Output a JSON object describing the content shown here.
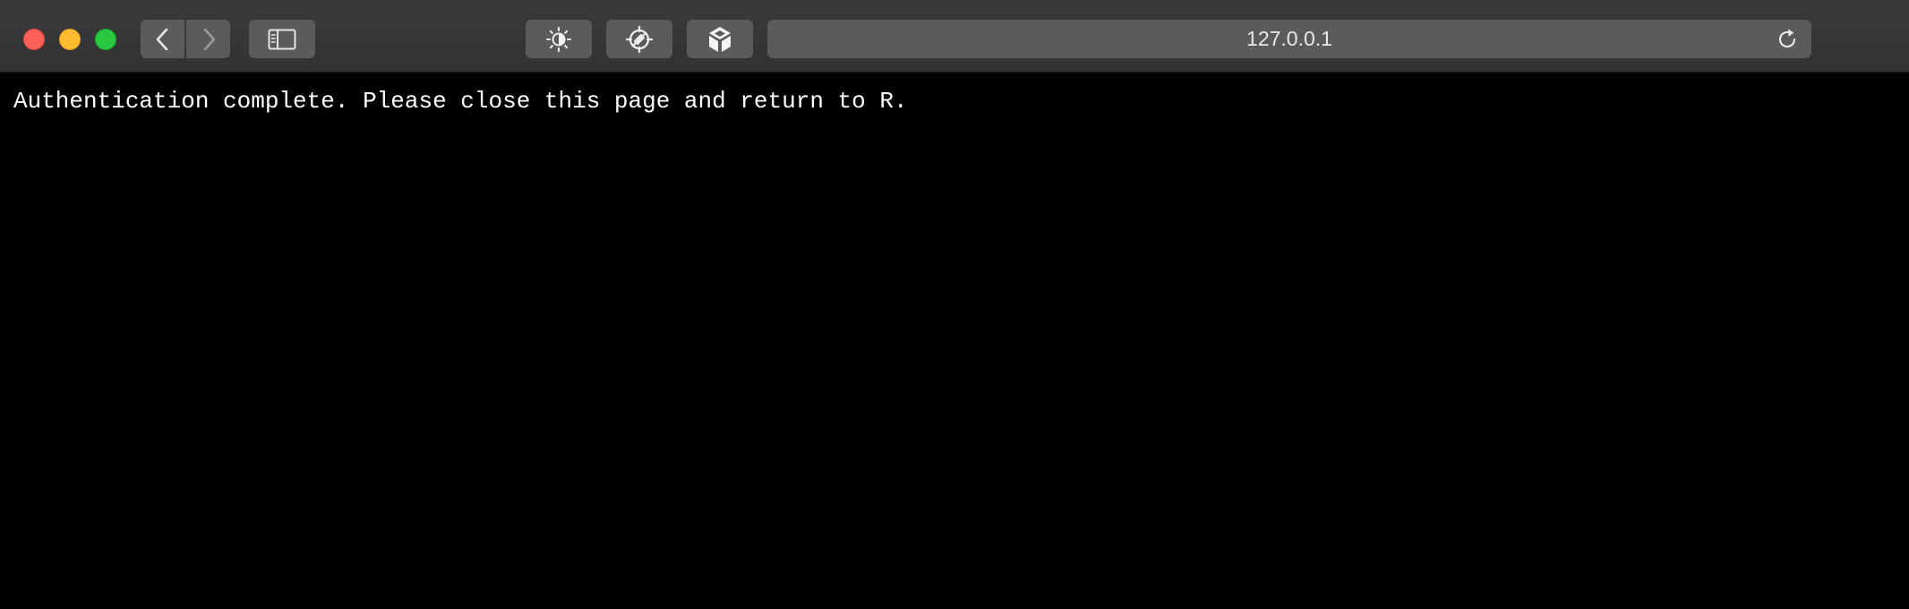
{
  "browser": {
    "address_bar": {
      "url": "127.0.0.1"
    },
    "toolbar_icons": {
      "back": "chevron-left-icon",
      "forward": "chevron-right-icon",
      "sidebar": "sidebar-icon",
      "extension_1": "brightness-icon",
      "extension_2": "target-blocked-icon",
      "extension_3": "cube-icon",
      "reload": "reload-icon"
    },
    "colors": {
      "close": "#fe5f57",
      "minimize": "#febc2e",
      "maximize": "#28c840",
      "toolbar_bg": "#353537",
      "button_bg": "#5b5b5e",
      "page_bg": "#000000",
      "page_text": "#ffffff"
    }
  },
  "page": {
    "message": "Authentication complete. Please close this page and return to R."
  }
}
